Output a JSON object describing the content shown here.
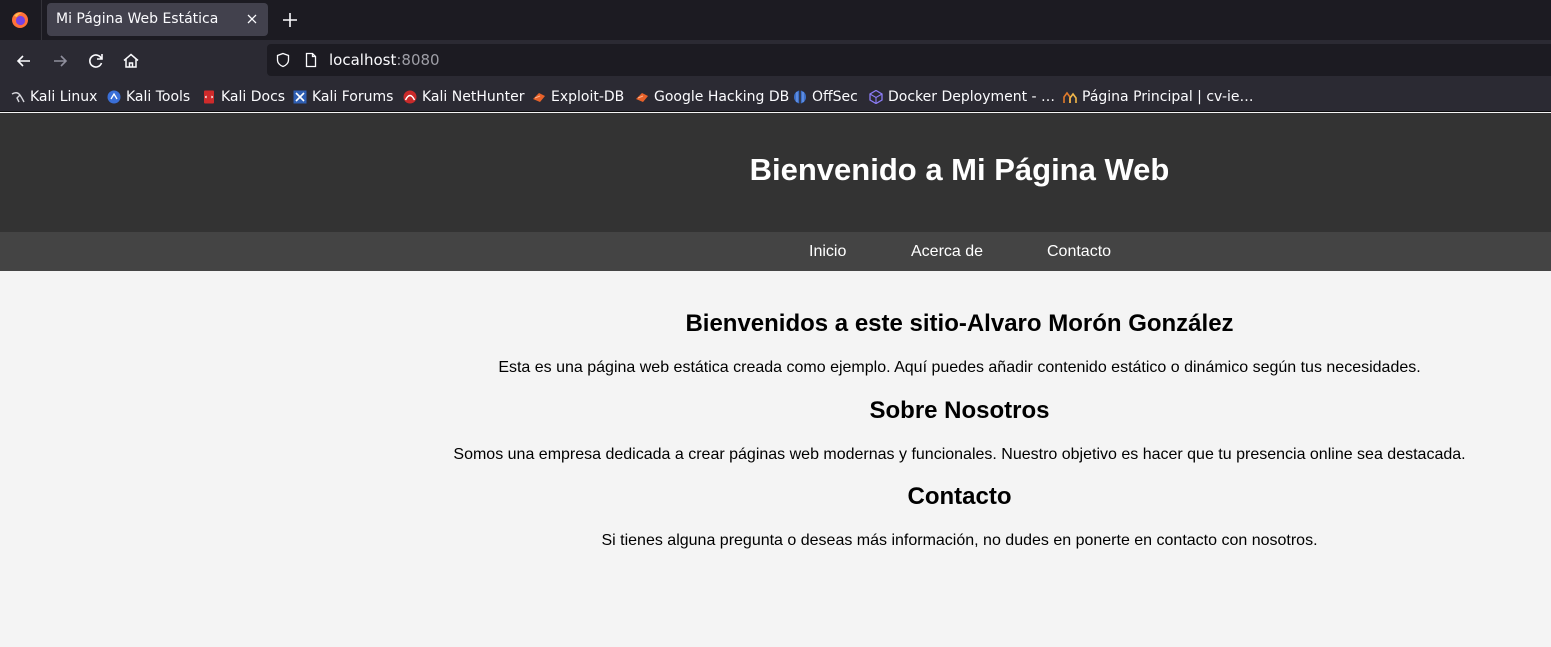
{
  "browser": {
    "tab": {
      "title": "Mi Página Web Estática"
    },
    "url": {
      "host": "localhost",
      "port": ":8080"
    },
    "bookmarks": [
      {
        "label": "Kali Linux",
        "icon": "kali-linux-icon"
      },
      {
        "label": "Kali Tools",
        "icon": "kali-tools-icon"
      },
      {
        "label": "Kali Docs",
        "icon": "kali-docs-icon"
      },
      {
        "label": "Kali Forums",
        "icon": "kali-forums-icon"
      },
      {
        "label": "Kali NetHunter",
        "icon": "kali-nethunter-icon"
      },
      {
        "label": "Exploit-DB",
        "icon": "exploit-db-icon"
      },
      {
        "label": "Google Hacking DB",
        "icon": "google-hacking-db-icon"
      },
      {
        "label": "OffSec",
        "icon": "offsec-icon"
      },
      {
        "label": "Docker Deployment - …",
        "icon": "docker-deployment-icon"
      },
      {
        "label": "Página Principal | cv-ie…",
        "icon": "cv-site-icon"
      }
    ]
  },
  "site": {
    "header": {
      "title": "Bienvenido a Mi Página Web"
    },
    "nav": {
      "links": [
        "Inicio",
        "Acerca de",
        "Contacto"
      ]
    },
    "sections": [
      {
        "heading": "Bienvenidos a este sitio-Alvaro Morón González",
        "text": "Esta es una página web estática creada como ejemplo. Aquí puedes añadir contenido estático o dinámico según tus necesidades."
      },
      {
        "heading": "Sobre Nosotros",
        "text": "Somos una empresa dedicada a crear páginas web modernas y funcionales. Nuestro objetivo es hacer que tu presencia online sea destacada."
      },
      {
        "heading": "Contacto",
        "text": "Si tienes alguna pregunta o deseas más información, no dudes en ponerte en contacto con nosotros."
      }
    ]
  },
  "colors": {
    "tab_strip": "#1c1b22",
    "toolbar": "#2b2a33",
    "site_header": "#333333",
    "site_nav": "#444444",
    "page_background": "#f4f4f4"
  }
}
